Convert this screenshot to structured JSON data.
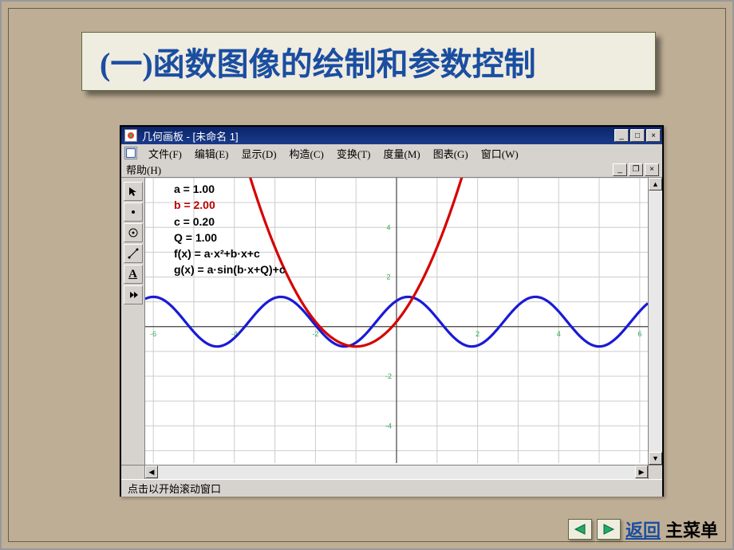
{
  "slide_title": "(一)函数图像的绘制和参数控制",
  "window": {
    "title": "几何画板 - [未命名 1]",
    "min": "_",
    "max": "□",
    "close": "×",
    "doc_min": "_",
    "doc_max": "❐",
    "doc_close": "×"
  },
  "menu": {
    "file": "文件(F)",
    "edit": "编辑(E)",
    "display": "显示(D)",
    "construct": "构造(C)",
    "transform": "变换(T)",
    "measure": "度量(M)",
    "graph": "图表(G)",
    "windowm": "窗口(W)",
    "help": "帮助(H)"
  },
  "params": {
    "a": "a = 1.00",
    "b": "b = 2.00",
    "c": "c = 0.20",
    "q": "Q = 1.00",
    "f": "f(x) = a·x²+b·x+c",
    "g": "g(x) = a·sin(b·x+Q)+c"
  },
  "statusbar": "点击以开始滚动窗口",
  "nav": {
    "back": "返回",
    "main": "主菜单"
  },
  "chart_data": {
    "type": "line",
    "title": "",
    "xlabel": "",
    "ylabel": "",
    "xlim": [
      -6.2,
      6.2
    ],
    "ylim": [
      -5.5,
      6
    ],
    "x_ticks": [
      -6,
      -4,
      -2,
      2,
      4,
      6
    ],
    "y_ticks": [
      -4,
      -2,
      2,
      4
    ],
    "series": [
      {
        "name": "g(x)=a·sin(b·x+Q)+c",
        "color": "#1a1ad6",
        "params": {
          "a": 1.0,
          "b": 2.0,
          "Q": 1.0,
          "c": 0.2
        },
        "formula": "1.0*sin(2.0*x+1.0)+0.2"
      },
      {
        "name": "f(x)=a·x²+b·x+c",
        "color": "#d60000",
        "params": {
          "a": 1.0,
          "b": 2.0,
          "c": 0.2
        },
        "formula": "1.0*x*x+2.0*x+0.2"
      }
    ]
  }
}
